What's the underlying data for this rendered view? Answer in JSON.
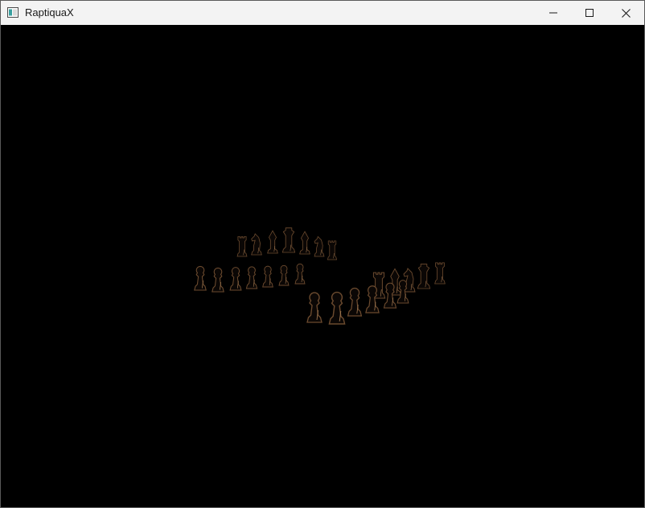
{
  "window": {
    "title": "RaptiquaX",
    "icon": "app-window-icon",
    "controls": {
      "minimize_icon": "minimize-icon",
      "maximize_icon": "maximize-icon",
      "close_icon": "close-icon"
    }
  },
  "viewport": {
    "background_color": "#000000",
    "piece_outline_color": "#6b4a2e",
    "piece_highlight_color": "#a07850"
  }
}
